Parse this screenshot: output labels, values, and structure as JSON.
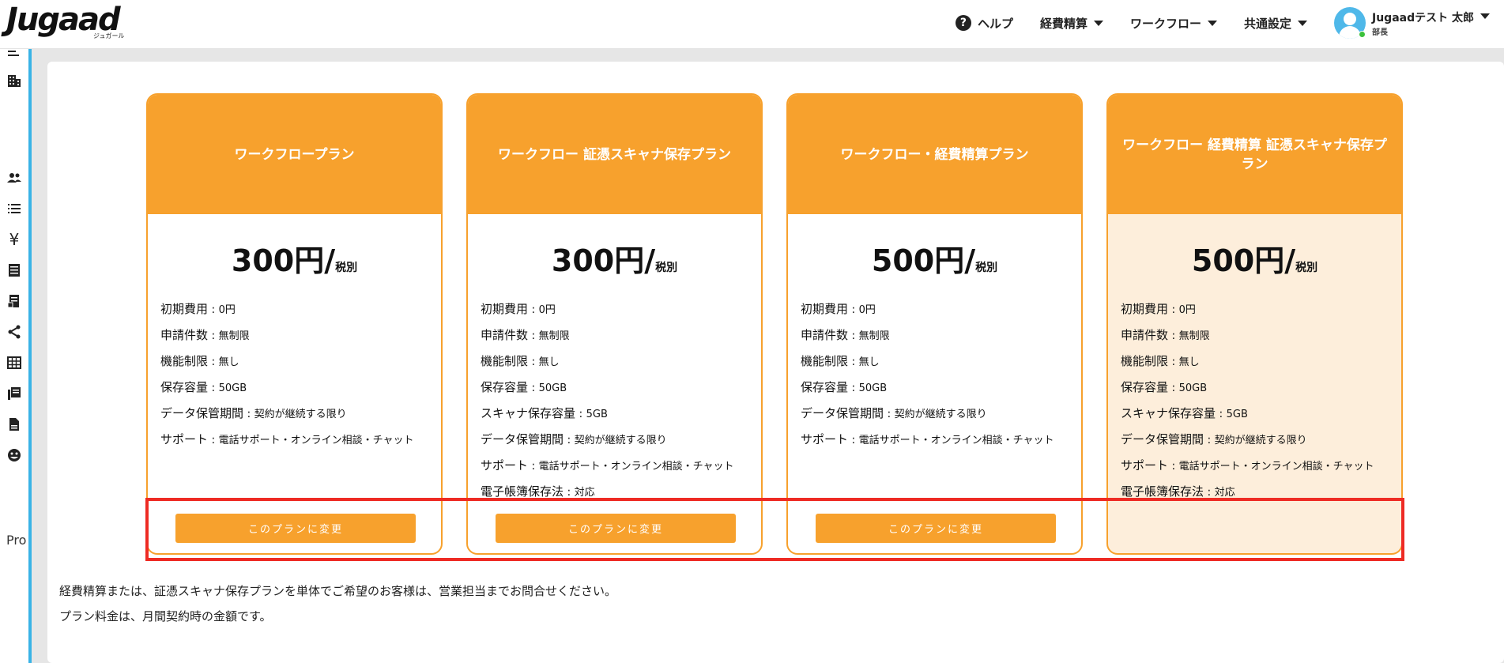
{
  "header": {
    "logo": "Jugaad",
    "logo_sub": "ジュガール",
    "nav": [
      {
        "label": "ヘルプ",
        "icon": "help-circle-icon"
      },
      {
        "label": "経費精算"
      },
      {
        "label": "ワークフロー"
      },
      {
        "label": "共通設定"
      }
    ],
    "user": {
      "name": "Jugaadテスト 太郎",
      "role": "部長"
    }
  },
  "sidebar": {
    "icons": [
      "menu-collapse-icon",
      "building-icon",
      "users-icon",
      "list-icon",
      "yen-icon",
      "receipt-icon",
      "document-icon",
      "share-icon",
      "table-icon",
      "library-icon",
      "file-icon",
      "face-icon"
    ],
    "partial_text": "Pro"
  },
  "plans": [
    {
      "title": "ワークフロープラン",
      "price": "300円/",
      "tax": "税別",
      "features": [
        {
          "label": "初期費用",
          "value": "0円"
        },
        {
          "label": "申請件数",
          "value": "無制限"
        },
        {
          "label": "機能制限",
          "value": "無し"
        },
        {
          "label": "保存容量",
          "value": "50GB"
        },
        {
          "label": "データ保管期間",
          "value": "契約が継続する限り"
        },
        {
          "label": "サポート",
          "value": "電話サポート・オンライン相談・チャット"
        }
      ],
      "button": "このプランに変更"
    },
    {
      "title": "ワークフロー 証憑スキャナ保存プラン",
      "price": "300円/",
      "tax": "税別",
      "features": [
        {
          "label": "初期費用",
          "value": "0円"
        },
        {
          "label": "申請件数",
          "value": "無制限"
        },
        {
          "label": "機能制限",
          "value": "無し"
        },
        {
          "label": "保存容量",
          "value": "50GB"
        },
        {
          "label": "スキャナ保存容量",
          "value": "5GB"
        },
        {
          "label": "データ保管期間",
          "value": "契約が継続する限り"
        },
        {
          "label": "サポート",
          "value": "電話サポート・オンライン相談・チャット"
        },
        {
          "label": "電子帳簿保存法",
          "value": "対応"
        }
      ],
      "button": "このプランに変更"
    },
    {
      "title": "ワークフロー・経費精算プラン",
      "price": "500円/",
      "tax": "税別",
      "features": [
        {
          "label": "初期費用",
          "value": "0円"
        },
        {
          "label": "申請件数",
          "value": "無制限"
        },
        {
          "label": "機能制限",
          "value": "無し"
        },
        {
          "label": "保存容量",
          "value": "50GB"
        },
        {
          "label": "データ保管期間",
          "value": "契約が継続する限り"
        },
        {
          "label": "サポート",
          "value": "電話サポート・オンライン相談・チャット"
        }
      ],
      "button": "このプランに変更"
    },
    {
      "title": "ワークフロー 経費精算 証憑スキャナ保存プラン",
      "price": "500円/",
      "tax": "税別",
      "current": true,
      "features": [
        {
          "label": "初期費用",
          "value": "0円"
        },
        {
          "label": "申請件数",
          "value": "無制限"
        },
        {
          "label": "機能制限",
          "value": "無し"
        },
        {
          "label": "保存容量",
          "value": "50GB"
        },
        {
          "label": "スキャナ保存容量",
          "value": "5GB"
        },
        {
          "label": "データ保管期間",
          "value": "契約が継続する限り"
        },
        {
          "label": "サポート",
          "value": "電話サポート・オンライン相談・チャット"
        },
        {
          "label": "電子帳簿保存法",
          "value": "対応"
        }
      ]
    }
  ],
  "notes": [
    "経費精算または、証憑スキャナ保存プランを単体でご希望のお客様は、営業担当までお問合せください。",
    "プラン料金は、月間契約時の金額です。"
  ],
  "colors": {
    "accent": "#f7a12d",
    "current_bg": "#fdeedb",
    "highlight": "#ee2b24",
    "sidebar_stripe": "#39b3e6"
  }
}
